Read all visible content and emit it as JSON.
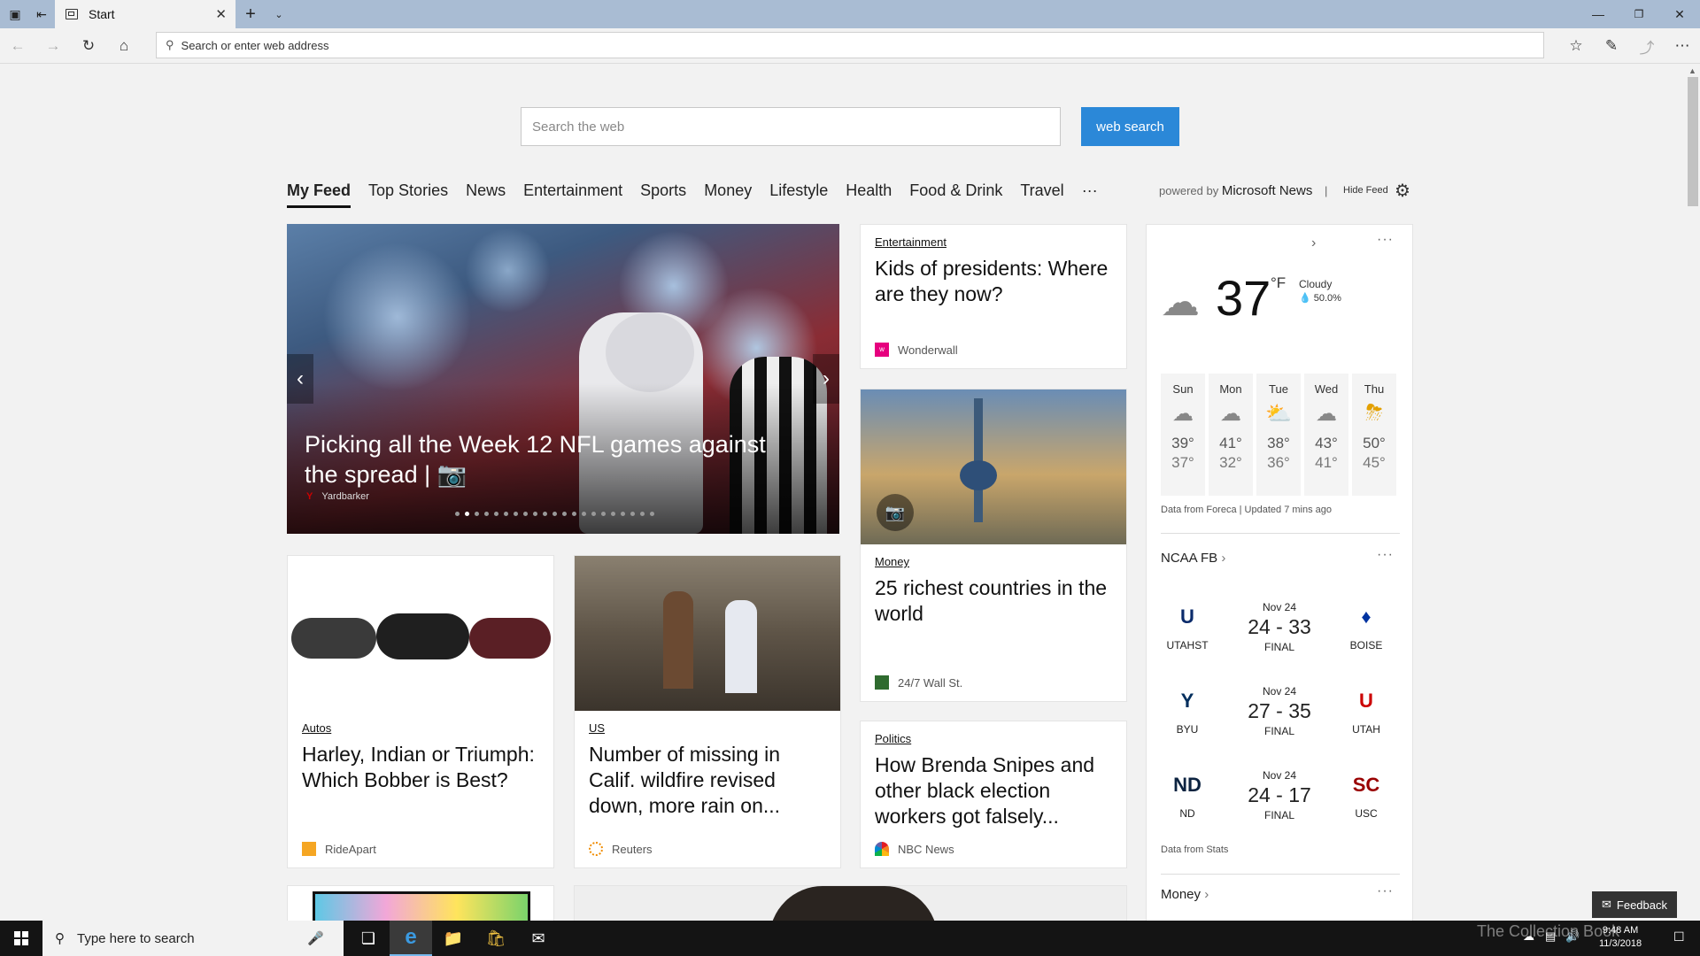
{
  "browser": {
    "tab_title": "Start",
    "address_placeholder": "Search or enter web address"
  },
  "search": {
    "placeholder": "Search the web",
    "button_label": "web search"
  },
  "feed_tabs": [
    "My Feed",
    "Top Stories",
    "News",
    "Entertainment",
    "Sports",
    "Money",
    "Lifestyle",
    "Health",
    "Food & Drink",
    "Travel",
    "···"
  ],
  "powered_by": {
    "prefix": "powered by",
    "brand": "Microsoft News",
    "separator": "|",
    "hide_feed": "Hide Feed"
  },
  "hero": {
    "title": "Picking all the Week 12 NFL games against the spread |",
    "source": "Yardbarker",
    "dots_total": 21,
    "dots_active": 2
  },
  "cards": {
    "kids": {
      "category": "Entertainment",
      "headline": "Kids of presidents: Where are they now?",
      "source": "Wonderwall"
    },
    "richest": {
      "category": "Money",
      "headline": "25 richest countries in the world",
      "source": "24/7 Wall St."
    },
    "bobber": {
      "category": "Autos",
      "headline": "Harley, Indian or Triumph: Which Bobber is Best?",
      "source": "RideApart"
    },
    "wildfire": {
      "category": "US",
      "headline": "Number of missing in Calif. wildfire revised down, more rain on...",
      "source": "Reuters"
    },
    "snipes": {
      "category": "Politics",
      "headline": "How Brenda Snipes and other black election workers got falsely...",
      "source": "NBC News"
    }
  },
  "weather": {
    "temp": "37",
    "unit": "°F",
    "condition": "Cloudy",
    "precip": "50.0%",
    "days": [
      {
        "day": "Sun",
        "icon": "cloud-icon",
        "hi": "39°",
        "lo": "37°"
      },
      {
        "day": "Mon",
        "icon": "cloud-icon",
        "hi": "41°",
        "lo": "32°"
      },
      {
        "day": "Tue",
        "icon": "partly-sunny-icon",
        "hi": "38°",
        "lo": "36°"
      },
      {
        "day": "Wed",
        "icon": "cloud-icon",
        "hi": "43°",
        "lo": "41°"
      },
      {
        "day": "Thu",
        "icon": "rain-sun-icon",
        "hi": "50°",
        "lo": "45°"
      }
    ],
    "credit": "Data from Foreca | Updated 7 mins ago"
  },
  "ncaa": {
    "title": "NCAA FB",
    "games": [
      {
        "date": "Nov 24",
        "score": "24 - 33",
        "status": "FINAL",
        "away": "UTAHST",
        "home": "BOISE"
      },
      {
        "date": "Nov 24",
        "score": "27 - 35",
        "status": "FINAL",
        "away": "BYU",
        "home": "UTAH"
      },
      {
        "date": "Nov 24",
        "score": "24 - 17",
        "status": "FINAL",
        "away": "ND",
        "home": "USC"
      }
    ],
    "credit": "Data from Stats"
  },
  "money_title": "Money",
  "feedback_label": "Feedback",
  "taskbar": {
    "search_placeholder": "Type here to search",
    "time": "9:48 AM",
    "date": "11/3/2018"
  },
  "watermark": "The Collection Book",
  "colors": {
    "accent": "#2b88d8",
    "titlebar": "#a9bcd3",
    "taskbar": "#141414"
  }
}
